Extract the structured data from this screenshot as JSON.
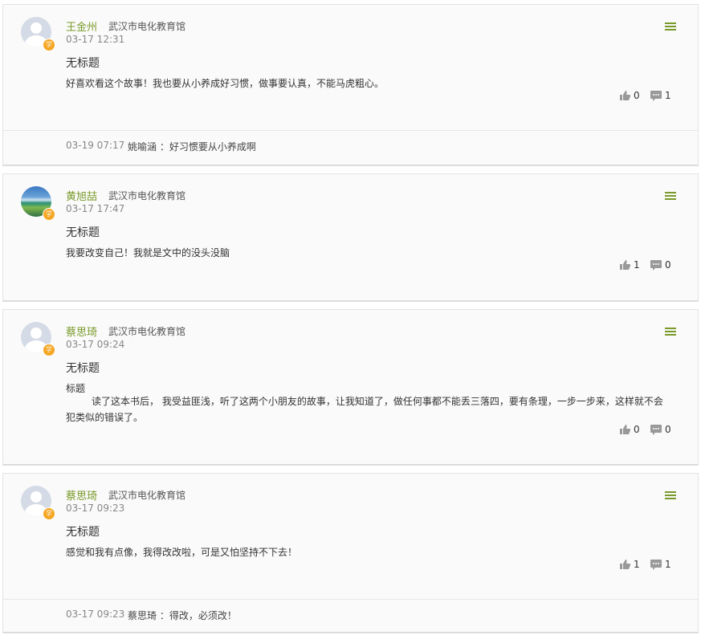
{
  "posts": [
    {
      "name": "王金州",
      "org": "武汉市电化教育馆",
      "time": "03-17 12:31",
      "title": "无标题",
      "content": "好喜欢看这个故事！我也要从小养成好习惯，做事要认真，不能马虎粗心。",
      "likes": "0",
      "comments": "1",
      "avatar": "default-avatar",
      "badge": "学",
      "reply": {
        "time": "03-19 07:17",
        "text": "姚喻涵 ：好习惯要从小养成啊"
      }
    },
    {
      "name": "黄旭喆",
      "org": "武汉市电化教育馆",
      "time": "03-17 17:47",
      "title": "无标题",
      "content": "我要改变自己！我就是文中的没头没脑",
      "likes": "1",
      "comments": "0",
      "avatar": "landscape-photo-avatar",
      "badge": "学"
    },
    {
      "name": "蔡思琦",
      "org": "武汉市电化教育馆",
      "time": "03-17 09:24",
      "title": "无标题",
      "content_label": "标题",
      "content": "读了这本书后， 我受益匪浅，听了这两个小朋友的故事，让我知道了，做任何事都不能丢三落四，要有条理，一步一步来，这样就不会犯类似的错误了。",
      "likes": "0",
      "comments": "0",
      "avatar": "default-avatar",
      "badge": "学"
    },
    {
      "name": "蔡思琦",
      "org": "武汉市电化教育馆",
      "time": "03-17 09:23",
      "title": "无标题",
      "content": "感觉和我有点像，我得改改啦，可是又怕坚持不下去！",
      "likes": "1",
      "comments": "1",
      "avatar": "default-avatar",
      "badge": "学",
      "reply": {
        "time": "03-17 09:23",
        "text": "蔡思琦 ：得改，必须改！"
      }
    }
  ],
  "colors": {
    "name": "#7a9a2a",
    "menu": "#7a9a2a",
    "badge": "#f5a623",
    "card_bg": "#fafafa"
  },
  "icons": {
    "like": "thumbs-up-icon",
    "comment": "speech-bubble-icon",
    "menu": "hamburger-menu-icon"
  }
}
